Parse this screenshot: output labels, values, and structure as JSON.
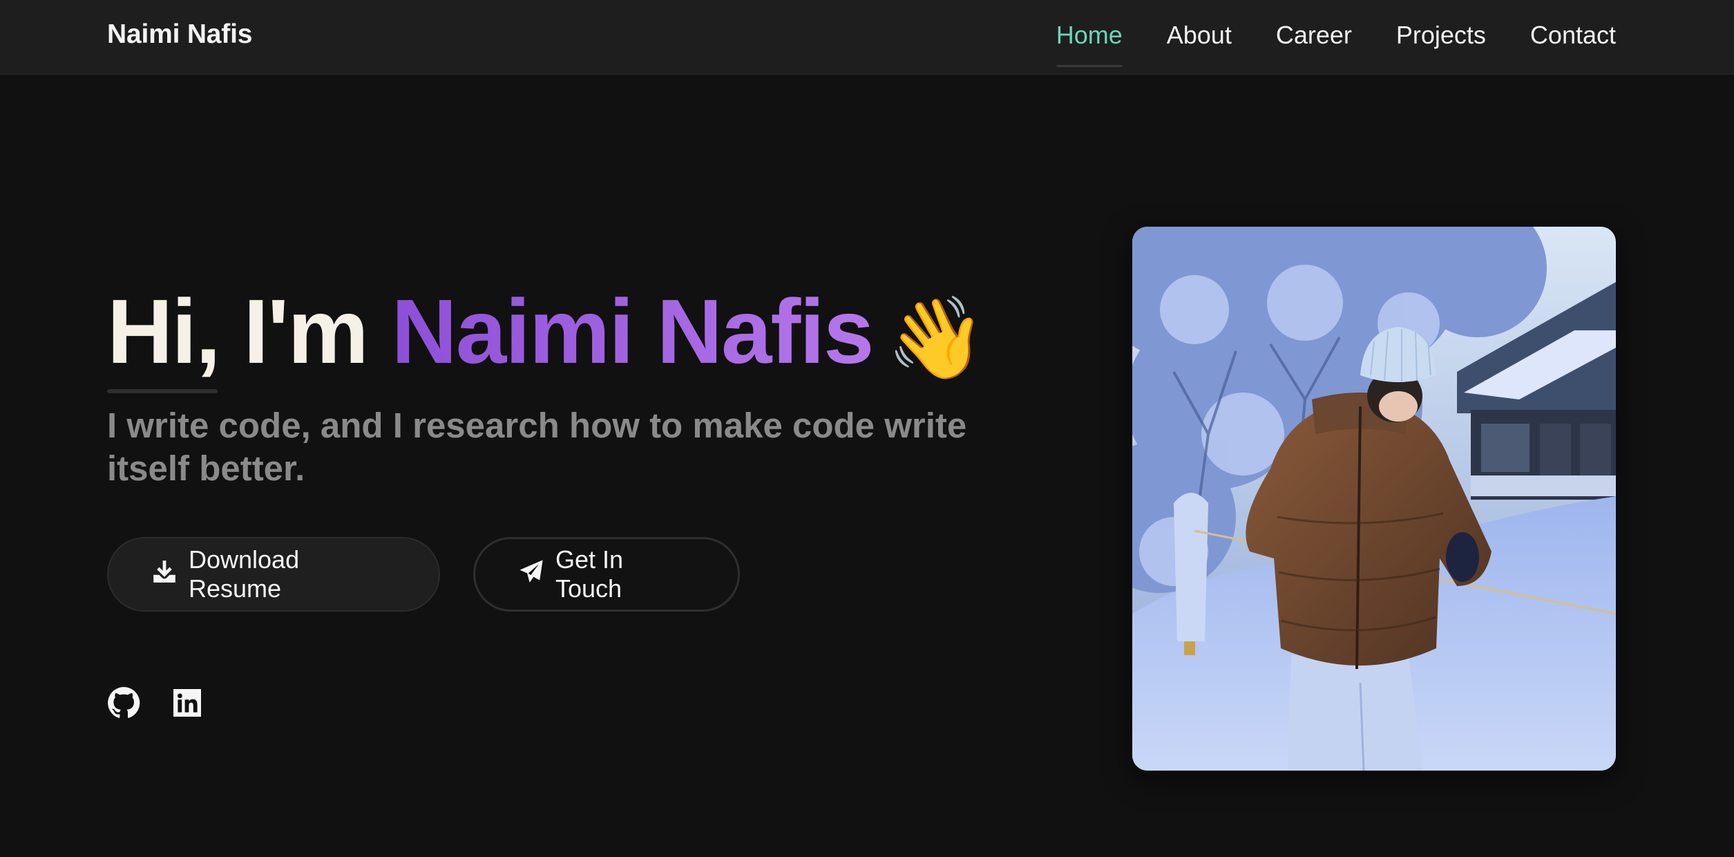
{
  "brand": "Naimi Nafis",
  "nav": {
    "home": "Home",
    "about": "About",
    "career": "Career",
    "projects": "Projects",
    "contact": "Contact",
    "active": "Home",
    "active_color": "#6fd3b8"
  },
  "hero": {
    "greeting": "Hi, I'm ",
    "name": "Naimi Nafis",
    "wave": "👋",
    "subtitle": "I write code, and I research how to make code write itself better.",
    "name_gradient": [
      "#8e4fd8",
      "#b677ea"
    ]
  },
  "buttons": {
    "resume": {
      "label": "Download Resume",
      "icon": "download-icon"
    },
    "contact": {
      "label": "Get In Touch",
      "icon": "paper-plane-icon"
    }
  },
  "socials": [
    {
      "name": "github-icon"
    },
    {
      "name": "linkedin-icon"
    }
  ],
  "photo": {
    "subject": "profile-photo"
  }
}
